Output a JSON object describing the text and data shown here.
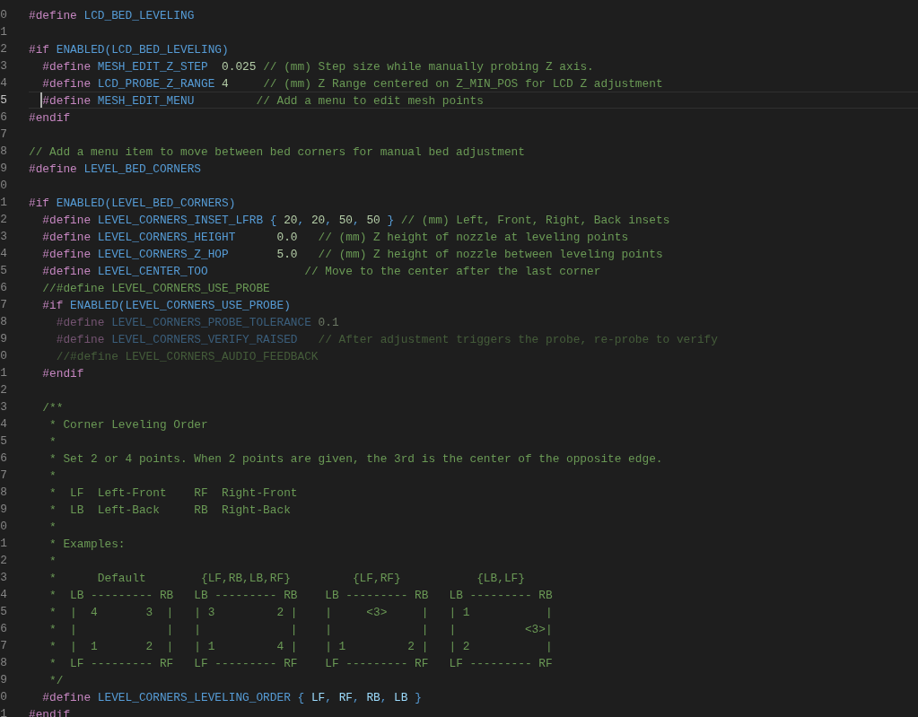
{
  "editor": {
    "lines": [
      {
        "number": "0",
        "current": false,
        "inactive": false,
        "tokens": [
          {
            "kind": "keyword",
            "text": "#define"
          },
          {
            "kind": "macro",
            "text": " LCD_BED_LEVELING"
          }
        ]
      },
      {
        "number": "1",
        "current": false,
        "inactive": false
      },
      {
        "number": "2",
        "current": false,
        "inactive": false,
        "tokens": [
          {
            "kind": "keyword",
            "text": "#if"
          },
          {
            "kind": "macro",
            "text": " ENABLED(LCD_BED_LEVELING)"
          }
        ]
      },
      {
        "number": "3",
        "current": false,
        "inactive": false,
        "tokens": [
          {
            "kind": "keyword",
            "text": "  #define"
          },
          {
            "kind": "macro",
            "text": " MESH_EDIT_Z_STEP"
          },
          {
            "kind": "number",
            "text": "  0.025"
          },
          {
            "kind": "comment",
            "text": " // (mm) Step size while manually probing Z axis."
          }
        ]
      },
      {
        "number": "4",
        "current": false,
        "inactive": false,
        "tokens": [
          {
            "kind": "keyword",
            "text": "  #define"
          },
          {
            "kind": "macro",
            "text": " LCD_PROBE_Z_RANGE"
          },
          {
            "kind": "number",
            "text": " 4"
          },
          {
            "kind": "comment",
            "text": "     // (mm) Z Range centered on Z_MIN_POS for LCD Z adjustment"
          }
        ]
      },
      {
        "number": "5",
        "current": true,
        "inactive": false,
        "tokens": [
          {
            "kind": "keyword",
            "text": "  #define"
          },
          {
            "kind": "macro",
            "text": " MESH_EDIT_MENU"
          },
          {
            "kind": "comment",
            "text": "         // Add a menu to edit mesh points"
          }
        ]
      },
      {
        "number": "6",
        "current": false,
        "inactive": false,
        "tokens": [
          {
            "kind": "keyword",
            "text": "#endif"
          }
        ]
      },
      {
        "number": "7",
        "current": false,
        "inactive": false
      },
      {
        "number": "8",
        "current": false,
        "inactive": false,
        "tokens": [
          {
            "kind": "comment",
            "text": "// Add a menu item to move between bed corners for manual bed adjustment"
          }
        ]
      },
      {
        "number": "9",
        "current": false,
        "inactive": false,
        "tokens": [
          {
            "kind": "keyword",
            "text": "#define"
          },
          {
            "kind": "macro",
            "text": " LEVEL_BED_CORNERS"
          }
        ]
      },
      {
        "number": "0",
        "current": false,
        "inactive": false
      },
      {
        "number": "1",
        "current": false,
        "inactive": false,
        "tokens": [
          {
            "kind": "keyword",
            "text": "#if"
          },
          {
            "kind": "macro",
            "text": " ENABLED(LEVEL_BED_CORNERS)"
          }
        ]
      },
      {
        "number": "2",
        "current": false,
        "inactive": false,
        "tokens": [
          {
            "kind": "keyword",
            "text": "  #define"
          },
          {
            "kind": "macro",
            "text": " LEVEL_CORNERS_INSET_LFRB"
          },
          {
            "kind": "punct",
            "text": " {"
          },
          {
            "kind": "number",
            "text": " 20"
          },
          {
            "kind": "punct",
            "text": ","
          },
          {
            "kind": "number",
            "text": " 20"
          },
          {
            "kind": "punct",
            "text": ","
          },
          {
            "kind": "number",
            "text": " 50"
          },
          {
            "kind": "punct",
            "text": ","
          },
          {
            "kind": "number",
            "text": " 50"
          },
          {
            "kind": "punct",
            "text": " }"
          },
          {
            "kind": "comment",
            "text": " // (mm) Left, Front, Right, Back insets"
          }
        ]
      },
      {
        "number": "3",
        "current": false,
        "inactive": false,
        "tokens": [
          {
            "kind": "keyword",
            "text": "  #define"
          },
          {
            "kind": "macro",
            "text": " LEVEL_CORNERS_HEIGHT"
          },
          {
            "kind": "number",
            "text": "      0.0"
          },
          {
            "kind": "comment",
            "text": "   // (mm) Z height of nozzle at leveling points"
          }
        ]
      },
      {
        "number": "4",
        "current": false,
        "inactive": false,
        "tokens": [
          {
            "kind": "keyword",
            "text": "  #define"
          },
          {
            "kind": "macro",
            "text": " LEVEL_CORNERS_Z_HOP"
          },
          {
            "kind": "number",
            "text": "       5.0"
          },
          {
            "kind": "comment",
            "text": "   // (mm) Z height of nozzle between leveling points"
          }
        ]
      },
      {
        "number": "5",
        "current": false,
        "inactive": false,
        "tokens": [
          {
            "kind": "keyword",
            "text": "  #define"
          },
          {
            "kind": "macro",
            "text": " LEVEL_CENTER_TOO"
          },
          {
            "kind": "comment",
            "text": "              // Move to the center after the last corner"
          }
        ]
      },
      {
        "number": "6",
        "current": false,
        "inactive": false,
        "tokens": [
          {
            "kind": "comment",
            "text": "  //#define LEVEL_CORNERS_USE_PROBE"
          }
        ]
      },
      {
        "number": "7",
        "current": false,
        "inactive": false,
        "tokens": [
          {
            "kind": "keyword",
            "text": "  #if"
          },
          {
            "kind": "macro",
            "text": " ENABLED(LEVEL_CORNERS_USE_PROBE)"
          }
        ]
      },
      {
        "number": "8",
        "current": false,
        "inactive": true,
        "tokens": [
          {
            "kind": "keyword",
            "text": "    #define"
          },
          {
            "kind": "macro",
            "text": " LEVEL_CORNERS_PROBE_TOLERANCE"
          },
          {
            "kind": "number",
            "text": " 0.1"
          }
        ]
      },
      {
        "number": "9",
        "current": false,
        "inactive": true,
        "tokens": [
          {
            "kind": "keyword",
            "text": "    #define"
          },
          {
            "kind": "macro",
            "text": " LEVEL_CORNERS_VERIFY_RAISED"
          },
          {
            "kind": "comment",
            "text": "   // After adjustment triggers the probe, re-probe to verify"
          }
        ]
      },
      {
        "number": "0",
        "current": false,
        "inactive": true,
        "tokens": [
          {
            "kind": "comment",
            "text": "    //#define LEVEL_CORNERS_AUDIO_FEEDBACK"
          }
        ]
      },
      {
        "number": "1",
        "current": false,
        "inactive": false,
        "tokens": [
          {
            "kind": "keyword",
            "text": "  #endif"
          }
        ]
      },
      {
        "number": "2",
        "current": false,
        "inactive": false
      },
      {
        "number": "3",
        "current": false,
        "inactive": false,
        "tokens": [
          {
            "kind": "comment",
            "text": "  /**"
          }
        ]
      },
      {
        "number": "4",
        "current": false,
        "inactive": false,
        "tokens": [
          {
            "kind": "comment",
            "text": "   * Corner Leveling Order"
          }
        ]
      },
      {
        "number": "5",
        "current": false,
        "inactive": false,
        "tokens": [
          {
            "kind": "comment",
            "text": "   *"
          }
        ]
      },
      {
        "number": "6",
        "current": false,
        "inactive": false,
        "tokens": [
          {
            "kind": "comment",
            "text": "   * Set 2 or 4 points. When 2 points are given, the 3rd is the center of the opposite edge."
          }
        ]
      },
      {
        "number": "7",
        "current": false,
        "inactive": false,
        "tokens": [
          {
            "kind": "comment",
            "text": "   *"
          }
        ]
      },
      {
        "number": "8",
        "current": false,
        "inactive": false,
        "tokens": [
          {
            "kind": "comment",
            "text": "   *  LF  Left-Front    RF  Right-Front"
          }
        ]
      },
      {
        "number": "9",
        "current": false,
        "inactive": false,
        "tokens": [
          {
            "kind": "comment",
            "text": "   *  LB  Left-Back     RB  Right-Back"
          }
        ]
      },
      {
        "number": "0",
        "current": false,
        "inactive": false,
        "tokens": [
          {
            "kind": "comment",
            "text": "   *"
          }
        ]
      },
      {
        "number": "1",
        "current": false,
        "inactive": false,
        "tokens": [
          {
            "kind": "comment",
            "text": "   * Examples:"
          }
        ]
      },
      {
        "number": "2",
        "current": false,
        "inactive": false,
        "tokens": [
          {
            "kind": "comment",
            "text": "   *"
          }
        ]
      },
      {
        "number": "3",
        "current": false,
        "inactive": false,
        "tokens": [
          {
            "kind": "comment",
            "text": "   *      Default        {LF,RB,LB,RF}         {LF,RF}           {LB,LF}"
          }
        ]
      },
      {
        "number": "4",
        "current": false,
        "inactive": false,
        "tokens": [
          {
            "kind": "comment",
            "text": "   *  LB --------- RB   LB --------- RB    LB --------- RB   LB --------- RB"
          }
        ]
      },
      {
        "number": "5",
        "current": false,
        "inactive": false,
        "tokens": [
          {
            "kind": "comment",
            "text": "   *  |  4       3  |   | 3         2 |    |     <3>     |   | 1           |"
          }
        ]
      },
      {
        "number": "6",
        "current": false,
        "inactive": false,
        "tokens": [
          {
            "kind": "comment",
            "text": "   *  |             |   |             |    |             |   |          <3>|"
          }
        ]
      },
      {
        "number": "7",
        "current": false,
        "inactive": false,
        "tokens": [
          {
            "kind": "comment",
            "text": "   *  |  1       2  |   | 1         4 |    | 1         2 |   | 2           |"
          }
        ]
      },
      {
        "number": "8",
        "current": false,
        "inactive": false,
        "tokens": [
          {
            "kind": "comment",
            "text": "   *  LF --------- RF   LF --------- RF    LF --------- RF   LF --------- RF"
          }
        ]
      },
      {
        "number": "9",
        "current": false,
        "inactive": false,
        "tokens": [
          {
            "kind": "comment",
            "text": "   */"
          }
        ]
      },
      {
        "number": "0",
        "current": false,
        "inactive": false,
        "tokens": [
          {
            "kind": "keyword",
            "text": "  #define"
          },
          {
            "kind": "macro",
            "text": " LEVEL_CORNERS_LEVELING_ORDER"
          },
          {
            "kind": "punct",
            "text": " {"
          },
          {
            "kind": "ident",
            "text": " LF"
          },
          {
            "kind": "punct",
            "text": ","
          },
          {
            "kind": "ident",
            "text": " RF"
          },
          {
            "kind": "punct",
            "text": ","
          },
          {
            "kind": "ident",
            "text": " RB"
          },
          {
            "kind": "punct",
            "text": ","
          },
          {
            "kind": "ident",
            "text": " LB"
          },
          {
            "kind": "punct",
            "text": " }"
          }
        ]
      },
      {
        "number": "1",
        "current": false,
        "inactive": false,
        "tokens": [
          {
            "kind": "keyword",
            "text": "#endif"
          }
        ]
      }
    ]
  }
}
